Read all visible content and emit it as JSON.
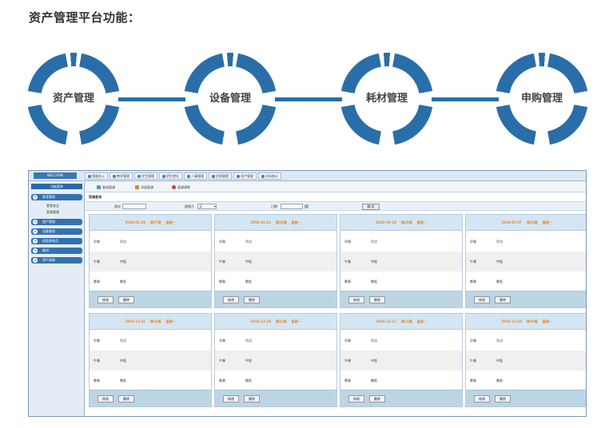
{
  "heading": "资产管理平台功能：",
  "features": [
    "资产管理",
    "设备管理",
    "耗材管理",
    "申购管理"
  ],
  "app": {
    "welcome": "WELCOME",
    "menu": [
      "智能办公",
      "教学管理",
      "学生管理",
      "招生就业",
      "人事管理",
      "信息管理",
      "资产管理",
      "分析统计"
    ],
    "sidebar": {
      "header": "功能菜单",
      "groups": [
        "食堂管理",
        "固产管理",
        "设备管理",
        "低值易耗品",
        "耗材",
        "资产采购"
      ],
      "sub_items": [
        "食堂安全",
        "菜谱管理"
      ]
    },
    "toolbar": {
      "query": "查询菜谱",
      "add": "添加菜谱",
      "clear": "菜谱清除"
    },
    "section_title": "菜谱查询",
    "search": {
      "week_label": "周次",
      "weekday_label": "星期几",
      "weekday_value": "无",
      "date_label": "日期",
      "submit": "确 定"
    },
    "cards": [
      {
        "date": "2018-01-28",
        "week": "第27周",
        "day": "星期一"
      },
      {
        "date": "2018-01-21",
        "week": "第26周",
        "day": "星期一"
      },
      {
        "date": "2018-01-14",
        "week": "第25周",
        "day": "星期一"
      },
      {
        "date": "2018-01-07",
        "week": "第24周",
        "day": "星期一"
      },
      {
        "date": "2018-12-31",
        "week": "第23周",
        "day": "星期一"
      },
      {
        "date": "2018-12-24",
        "week": "第22周",
        "day": "星期一"
      },
      {
        "date": "2018-12-17",
        "week": "第21周",
        "day": "星期一"
      },
      {
        "date": "2018-12-10",
        "week": "第20周",
        "day": "星期一"
      }
    ],
    "meals": [
      {
        "meal": "早餐",
        "dish": "早点"
      },
      {
        "meal": "午餐",
        "dish": "中饭"
      },
      {
        "meal": "晚餐",
        "dish": "晚饭"
      }
    ],
    "card_buttons": {
      "edit": "修改",
      "delete": "删除"
    },
    "colors": {
      "brand": "#2a6ea9",
      "date_accent": "#e8862b"
    }
  }
}
